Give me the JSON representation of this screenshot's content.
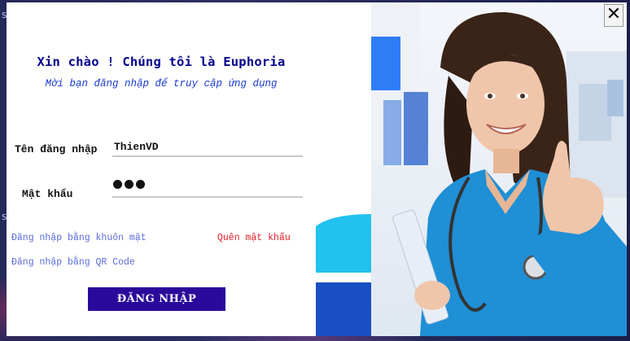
{
  "dialog": {
    "title": "Xin chào ! Chúng tôi là Euphoria",
    "subtitle": "Mời bạn đăng nhập để truy cập ứng dụng",
    "close_label": "✕"
  },
  "form": {
    "username_label": "Tên đăng nhập",
    "username_value": "ThienVD",
    "password_label": "Mật khẩu",
    "password_masked_count": 3
  },
  "links": {
    "face_login": "Đăng nhập bằng khuôn mặt",
    "forgot_password": "Quên mật khẩu",
    "qr_login": "Đăng nhập bằng QR Code"
  },
  "actions": {
    "login_label": "ĐĂNG NHẬP"
  },
  "colors": {
    "title": "#00008b",
    "subtitle": "#1a3ad0",
    "link_blue": "#5a6cd6",
    "link_red": "#e0202a",
    "login_button": "#2a0a9a",
    "accent_blue": "#2f7df6"
  },
  "illustration": {
    "icon": "smiling-doctor-thumbs-up-photo"
  }
}
